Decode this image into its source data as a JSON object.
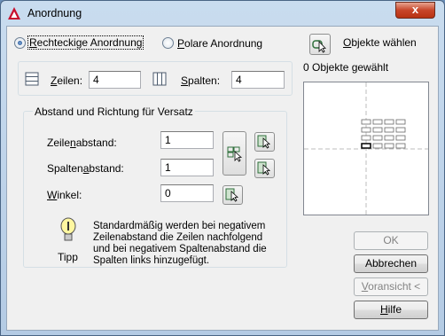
{
  "window": {
    "title": "Anordnung",
    "close_symbol": "x"
  },
  "arrangement": {
    "rect_label_prefix": "R",
    "rect_label_rest": "echteckige Anordnung",
    "polar_label_prefix": "P",
    "polar_label_rest": "olare Anordnung",
    "selected": "rectangular"
  },
  "rows": {
    "label_prefix": "Z",
    "label_rest": "eilen:",
    "value": "4"
  },
  "columns": {
    "label_prefix": "S",
    "label_rest": "palten:",
    "value": "4"
  },
  "offset": {
    "group_title": "Abstand und Richtung für Versatz",
    "row_spacing": {
      "label_prefix": "Zeile",
      "label_mid": "n",
      "label_rest": "abstand:",
      "value": "1"
    },
    "column_spacing": {
      "label_prefix": "Spalten",
      "label_mid": "a",
      "label_rest": "bstand:",
      "value": "1"
    },
    "angle": {
      "label_prefix": "W",
      "label_rest": "inkel:",
      "value": "0"
    }
  },
  "tip": {
    "text": "Standardmäßig werden bei negativem Zeilenabstand die Zeilen nachfolgend und bei negativem Spaltenabstand die Spalten links hinzugefügt.",
    "label": "Tipp"
  },
  "select_objects": {
    "label_prefix": "O",
    "label_rest": "bjekte wählen",
    "count_text": "0 Objekte gewählt"
  },
  "buttons": {
    "ok": "OK",
    "cancel": "Abbrechen",
    "preview_prefix": "V",
    "preview_rest": "oransicht <",
    "help_prefix": "H",
    "help_rest": "ilfe"
  },
  "preview": {
    "rows": 4,
    "columns": 4
  },
  "colors": {
    "accent": "#c7452a",
    "title_bg": "#b4cbe4"
  }
}
